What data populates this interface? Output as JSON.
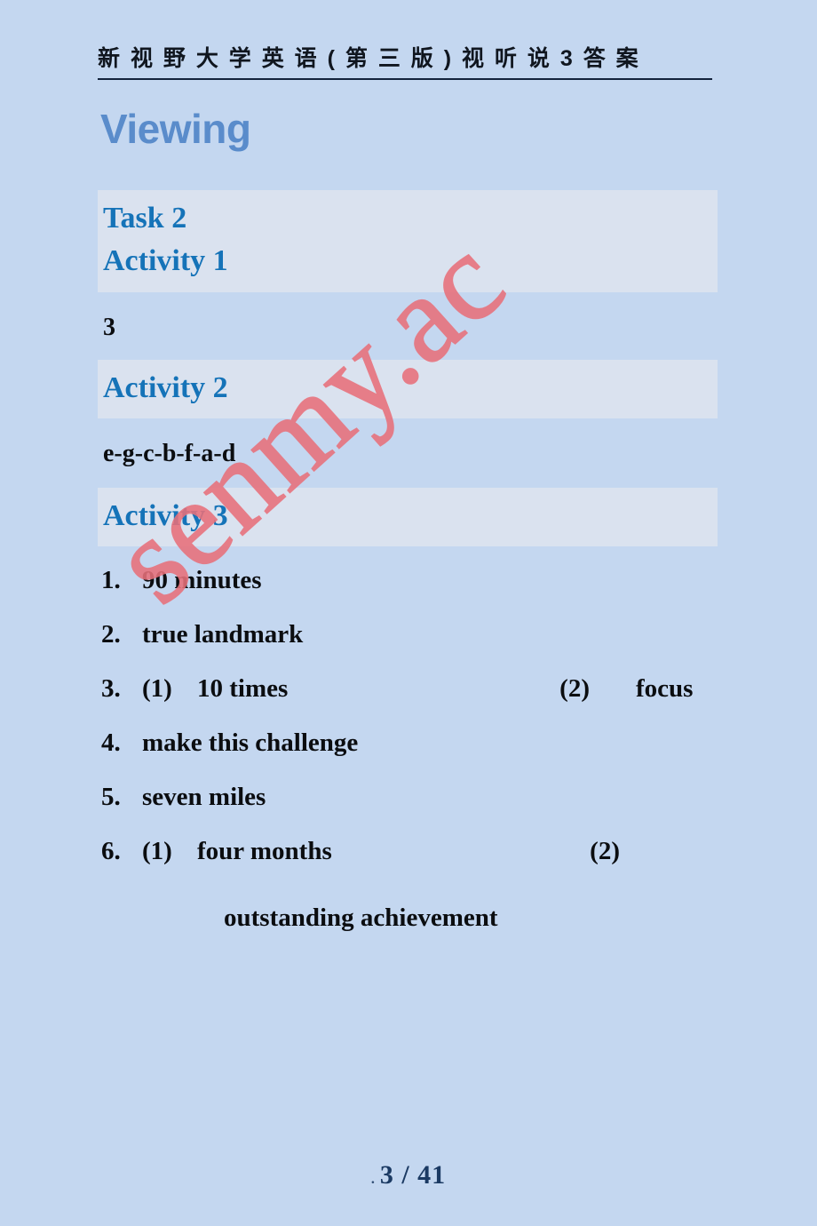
{
  "document": {
    "header_title": "新 视 野 大 学 英 语 ( 第 三 版 ) 视 听 说  3 答 案",
    "section_title": "Viewing",
    "watermark": "senmy.ac"
  },
  "blocks": {
    "task_heading": "Task 2",
    "activity1_heading": "Activity 1",
    "activity1_answer": "3",
    "activity2_heading": "Activity 2",
    "activity2_answer": "e-g-c-b-f-a-d",
    "activity3_heading": "Activity 3"
  },
  "activity3_answers": [
    {
      "num": "1.",
      "sub": "",
      "text": "90 minutes",
      "sub2": "",
      "text2": ""
    },
    {
      "num": "2.",
      "sub": "",
      "text": "true landmark",
      "sub2": "",
      "text2": ""
    },
    {
      "num": "3.",
      "sub": "(1)",
      "text": "10 times",
      "sub2": "(2)",
      "text2": "focus"
    },
    {
      "num": "4.",
      "sub": "",
      "text": "make this challenge",
      "sub2": "",
      "text2": ""
    },
    {
      "num": "5.",
      "sub": "",
      "text": "seven miles",
      "sub2": "",
      "text2": ""
    },
    {
      "num": "6.",
      "sub": "(1)",
      "text": "four months",
      "sub2": "(2)",
      "text2": ""
    }
  ],
  "activity3_continued": "outstanding achievement",
  "footer": {
    "dot": ".",
    "page_label": "3 / 41"
  },
  "colors": {
    "page_background": "#c4d7f0",
    "band_background": "#dae2ef",
    "heading_blue": "#1573b8",
    "section_title_blue": "#5a8ccb",
    "body_black": "#0b0d10",
    "watermark_red": "#e8707a",
    "footer_navy": "#1b3a63"
  }
}
